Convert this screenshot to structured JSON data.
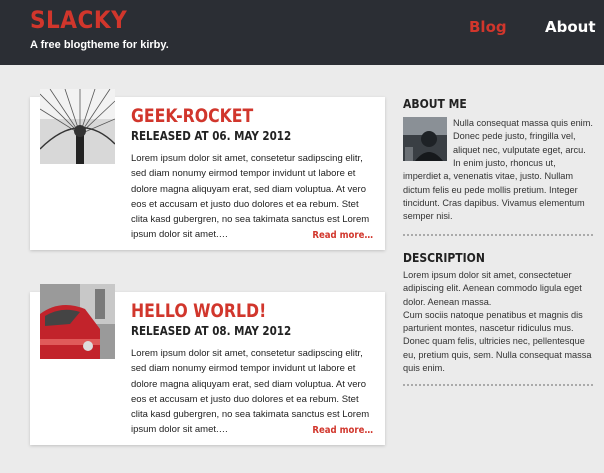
{
  "site": {
    "title": "SLACKY",
    "tagline": "A free blogtheme for kirby."
  },
  "nav": {
    "items": [
      {
        "label": "Blog",
        "active": true
      },
      {
        "label": "About",
        "active": false
      }
    ]
  },
  "posts": [
    {
      "title": "GEEK-ROCKET",
      "date": "RELEASED AT 06. MAY 2012",
      "excerpt": "Lorem ipsum dolor sit amet, consetetur sadipscing elitr, sed diam nonumy eirmod tempor invidunt ut labore et dolore magna aliquyam erat, sed diam voluptua. At vero eos et accusam et justo duo dolores et ea rebum. Stet clita kasd gubergren, no sea takimata sanctus est Lorem ipsum dolor sit amet.…",
      "read_more": "Read more…",
      "thumbnail": "ferris-wheel-icon"
    },
    {
      "title": "HELLO WORLD!",
      "date": "RELEASED AT 08. MAY 2012",
      "excerpt": "Lorem ipsum dolor sit amet, consetetur sadipscing elitr, sed diam nonumy eirmod tempor invidunt ut labore et dolore magna aliquyam erat, sed diam voluptua. At vero eos et accusam et justo duo dolores et ea rebum. Stet clita kasd gubergren, no sea takimata sanctus est Lorem ipsum dolor sit amet.…",
      "read_more": "Read more…",
      "thumbnail": "red-car-icon"
    }
  ],
  "sidebar": {
    "about": {
      "heading": "ABOUT ME",
      "text_side": "Nulla consequat massa quis enim. Donec pede justo, fringilla vel, aliquet nec, vulputate eget, arcu.",
      "text_below": "In enim justo, rhoncus ut, imperdiet a, venenatis vitae, justo. Nullam dictum felis eu pede mollis pretium. Integer tincidunt. Cras dapibus. Vivamus elementum semper nisi.",
      "image": "portrait-icon"
    },
    "description": {
      "heading": "DESCRIPTION",
      "text": "Lorem ipsum dolor sit amet, consectetuer adipiscing elit. Aenean commodo ligula eget dolor. Aenean massa.",
      "text2": "Cum sociis natoque penatibus et magnis dis parturient montes, nascetur ridiculus mus. Donec quam felis, ultricies nec, pellentesque eu, pretium quis, sem. Nulla consequat massa quis enim."
    }
  },
  "colors": {
    "accent": "#d1362c",
    "header_bg": "#2b2e34",
    "page_bg": "#ebebeb"
  }
}
